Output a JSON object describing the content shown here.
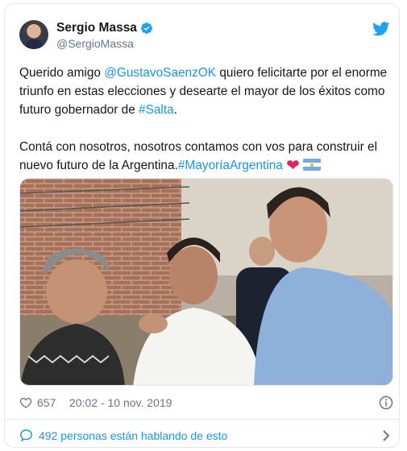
{
  "author": {
    "name": "Sergio Massa",
    "handle": "@SergioMassa"
  },
  "tweet": {
    "p1_pre": "Querido amigo ",
    "p1_mention": "@GustavoSaenzOK",
    "p1_mid": " quiero felicitarte por el enorme triunfo en estas elecciones y desearte el mayor de los éxitos como futuro gobernador de ",
    "p1_hashtag": "#Salta",
    "p1_post": ".",
    "p2_pre": "Contá con nosotros, nosotros contamos con vos para construir el nuevo futuro de la Argentina.",
    "p2_hashtag": "#MayoríaArgentina",
    "p2_heart": "❤"
  },
  "meta": {
    "likes": "657",
    "timestamp": "20:02 - 10 nov. 2019"
  },
  "footer": {
    "conversation": "492 personas están hablando de esto"
  },
  "icons": {
    "verified": "verified-badge-icon",
    "twitter": "twitter-bird-icon",
    "like": "heart-outline-icon",
    "info": "info-icon",
    "conversation": "speech-bubble-icon",
    "chevron": "chevron-right-icon"
  },
  "colors": {
    "link": "#1b95e0",
    "secondary_text": "#657786",
    "heart": "#e0245e"
  }
}
